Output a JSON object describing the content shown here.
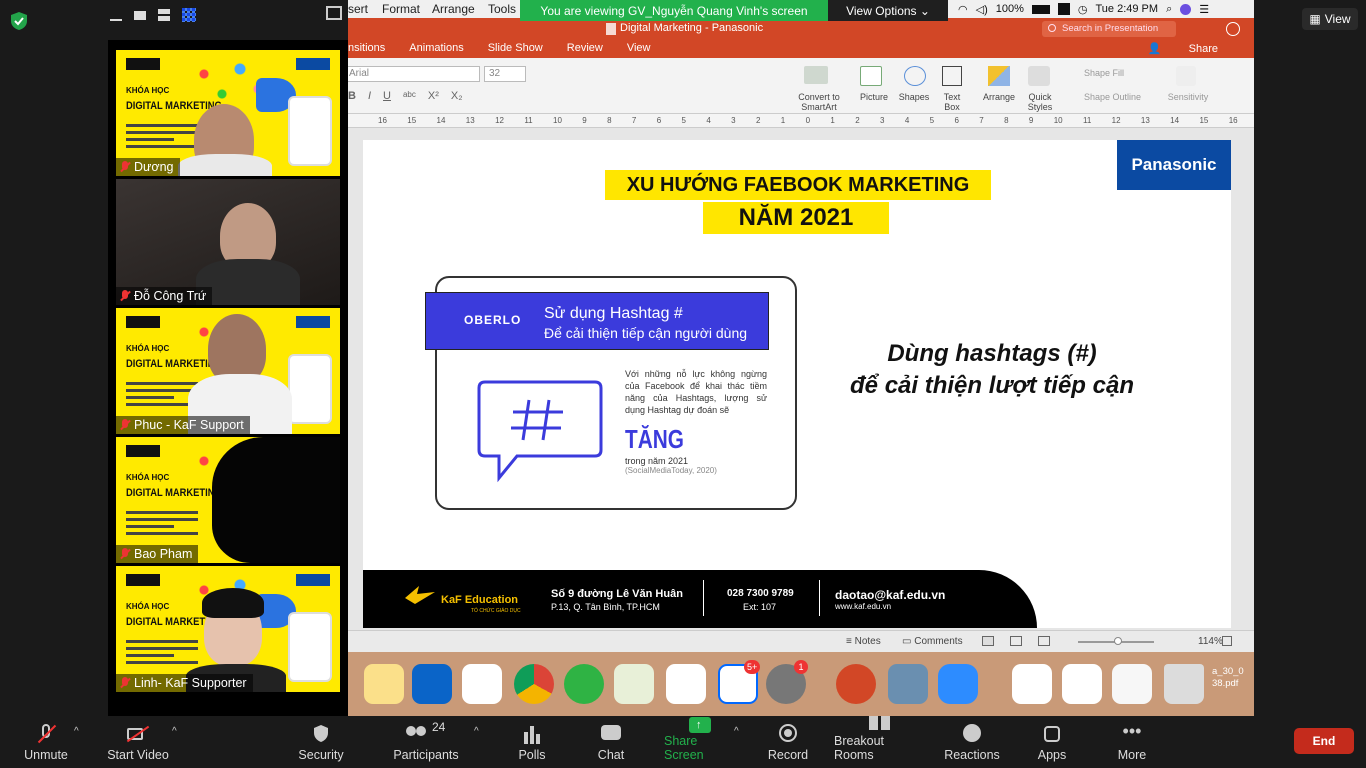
{
  "banner": {
    "text": "You are viewing GV_Nguyễn Quang Vinh's screen",
    "view_options": "View Options ⌄"
  },
  "view_button": "View",
  "gallery": {
    "participants": [
      {
        "name": "Dương"
      },
      {
        "name": "Đỗ Công Trứ"
      },
      {
        "name": "Phuc - KaF Support"
      },
      {
        "name": "Bao Pham"
      },
      {
        "name": "Linh- KaF Supporter"
      }
    ],
    "poster": {
      "khoa": "KHÓA HỌC",
      "title": "DIGITAL MARKETING"
    }
  },
  "ppt": {
    "menu": [
      "sert",
      "Format",
      "Arrange",
      "Tools"
    ],
    "title": "Digital Marketing - Panasonic",
    "search_placeholder": "Search in Presentation",
    "share": "Share",
    "tabs": [
      "nsitions",
      "Animations",
      "Slide Show",
      "Review",
      "View"
    ],
    "font_name": "Arial",
    "font_size": "32",
    "ribbon_labels": {
      "convert": "Convert to SmartArt",
      "picture": "Picture",
      "shapes": "Shapes",
      "textbox": "Text Box",
      "arrange": "Arrange",
      "quick_styles": "Quick Styles",
      "shape_fill": "Shape Fill",
      "shape_outline": "Shape Outline",
      "sensitivity": "Sensitivity"
    },
    "ruler_marks": [
      "16",
      "15",
      "14",
      "13",
      "12",
      "11",
      "10",
      "9",
      "8",
      "7",
      "6",
      "5",
      "4",
      "3",
      "2",
      "1",
      "0",
      "1",
      "2",
      "3",
      "4",
      "5",
      "6",
      "7",
      "8",
      "9",
      "10",
      "11",
      "12",
      "13",
      "14",
      "15",
      "16"
    ],
    "status": {
      "notes": "Notes",
      "comments": "Comments",
      "zoom": "114%"
    },
    "dock_badges": {
      "zalo": "5+",
      "settings": "1"
    },
    "dock_file": "a_30_0\n38.pdf"
  },
  "macbar": {
    "battery": "100%",
    "time": "Tue 2:49 PM"
  },
  "slide": {
    "title1": "XU HƯỚNG FAEBOOK MARKETING",
    "title2": "NĂM 2021",
    "brand": "Panasonic",
    "card_logo": "OBERLO",
    "card_head1": "Sử dụng Hashtag #",
    "card_head2": "Để cải thiện tiếp cận người dùng",
    "card_body": "Với những nỗ lực không ngừng của Facebook để khai thác tiềm năng của Hashtags, lượng sử dụng Hashtag dự đoán sẽ",
    "card_tang": "TĂNG",
    "card_year": "trong năm 2021",
    "card_src": "(SocialMediaToday, 2020)",
    "side1": "Dùng hashtags (#)",
    "side2": "để cải thiện lượt tiếp cận",
    "footer": {
      "kaf": "KaF Education",
      "kaf_sub": "TỔ CHỨC GIÁO DỤC",
      "addr1": "Số 9 đường Lê Văn Huân",
      "addr2": "P.13, Q. Tân Bình, TP.HCM",
      "phone": "028 7300 9789",
      "ext": "Ext: 107",
      "email": "daotao@kaf.edu.vn",
      "web": "www.kaf.edu.vn"
    }
  },
  "toolbar": {
    "unmute": "Unmute",
    "start_video": "Start Video",
    "security": "Security",
    "participants": "Participants",
    "participants_count": "24",
    "polls": "Polls",
    "chat": "Chat",
    "share_screen": "Share Screen",
    "record": "Record",
    "breakout": "Breakout Rooms",
    "reactions": "Reactions",
    "apps": "Apps",
    "more": "More",
    "end": "End"
  },
  "colors": {
    "zoom_bg": "#1a1a1a",
    "share_green": "#22b14c",
    "ppt_orange": "#d24726",
    "end_red": "#c42b1c",
    "slide_yellow": "#ffe600",
    "oberlo_blue": "#3b3bdc"
  }
}
